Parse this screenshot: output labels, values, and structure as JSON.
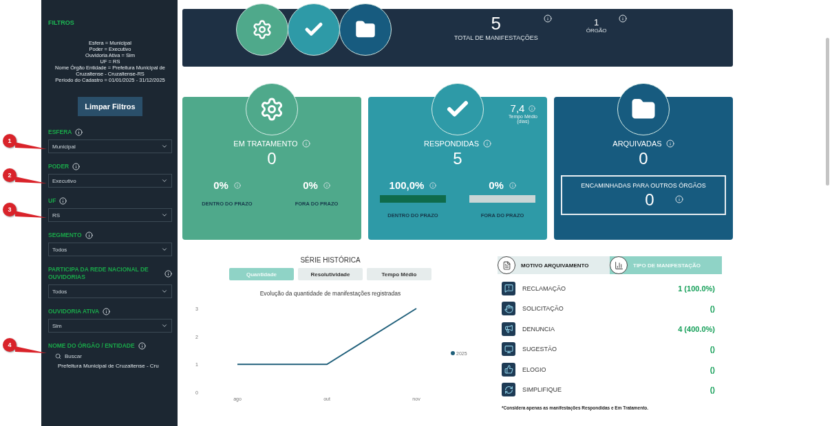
{
  "sidebar": {
    "filters_title": "FILTROS",
    "filter_summary": [
      "Esfera = Municipal",
      "Poder = Executivo",
      "Ouvidoria Ativa = Sim",
      "UF = RS",
      "Nome Órgão Entidade = Prefeitura Municipal de Cruzaltense - Cruzaltense-RS",
      "Período do Cadastro = 01/01/2025 - 31/12/2025"
    ],
    "clear_button": "Limpar Filtros",
    "filters": [
      {
        "kind": "select",
        "label": "ESFERA",
        "value": "Municipal",
        "marker": "1"
      },
      {
        "kind": "select",
        "label": "PODER",
        "value": "Executivo",
        "marker": "2"
      },
      {
        "kind": "select",
        "label": "UF",
        "value": "RS",
        "marker": "3"
      },
      {
        "kind": "select",
        "label": "SEGMENTO",
        "value": "Todos"
      },
      {
        "kind": "select",
        "label": "PARTICIPA DA REDE NACIONAL DE OUVIDORIAS",
        "value": "Todos"
      },
      {
        "kind": "select",
        "label": "OUVIDORIA ATIVA",
        "value": "Sim"
      },
      {
        "kind": "search",
        "label": "NOME DO ÓRGÃO / ENTIDADE",
        "placeholder": "Buscar",
        "option": "Prefeitura Municipal de Cruzaltense - Cru",
        "marker": "4"
      }
    ]
  },
  "summary_bar": {
    "total": "5",
    "total_label": "TOTAL DE MANIFESTAÇÕES",
    "orgs": "1",
    "orgs_label": "ÓRGÃO"
  },
  "cards": [
    {
      "kind": "gear",
      "title": "EM TRATAMENTO",
      "value": "0",
      "stats": [
        {
          "value": "0%",
          "label": "DENTRO DO PRAZO"
        },
        {
          "value": "0%",
          "label": "FORA DO PRAZO"
        }
      ]
    },
    {
      "kind": "check",
      "title": "RESPONDIDAS",
      "value": "5",
      "average": "7,4",
      "average_label": "Tempo Médio (dias)",
      "stats": [
        {
          "value": "100,0%",
          "label": "DENTRO DO PRAZO",
          "level": 1
        },
        {
          "value": "0%",
          "label": "FORA DO PRAZO",
          "level": 0
        }
      ]
    },
    {
      "kind": "folder",
      "title": "ARQUIVADAS",
      "value": "0",
      "forwarded": {
        "title": "ENCAMINHADAS PARA OUTROS ÓRGÃOS",
        "value": "0"
      }
    }
  ],
  "history": {
    "title": "SÉRIE HISTÓRICA",
    "tabs": [
      {
        "label": "Quantidade",
        "selected": true
      },
      {
        "label": "Resolutividade",
        "selected": false
      },
      {
        "label": "Tempo Médio",
        "selected": false
      }
    ],
    "chart_data": {
      "type": "line",
      "title": "Evolução da quantidade de manifestações registradas",
      "categories": [
        "ago",
        "out",
        "nov"
      ],
      "series": [
        {
          "name": "2025",
          "color": "#1f5f7a",
          "values": [
            1,
            1,
            3
          ]
        }
      ],
      "ylim": [
        0,
        3
      ],
      "yticks": [
        0,
        1,
        2,
        3
      ]
    }
  },
  "types": {
    "tabs": [
      {
        "kind": "archive",
        "label": "MOTIVO ARQUIVAMENTO",
        "selected": false
      },
      {
        "kind": "type",
        "label": "TIPO DE MANIFESTAÇÃO",
        "selected": true
      }
    ],
    "rows": [
      {
        "kind": "complaint",
        "label": "RECLAMAÇÃO",
        "value": "1 (100.0%)"
      },
      {
        "kind": "request",
        "label": "SOLICITAÇÃO",
        "value": "()"
      },
      {
        "kind": "report",
        "label": "DENUNCIA",
        "value": "4 (400.0%)"
      },
      {
        "kind": "suggestion",
        "label": "SUGESTÃO",
        "value": "()"
      },
      {
        "kind": "praise",
        "label": "ELOGIO",
        "value": "()"
      },
      {
        "kind": "simplify",
        "label": "SIMPLIFIQUE",
        "value": "()"
      }
    ],
    "footnote": "*Considera apenas as manifestações Respondidas e Em Tratamento."
  }
}
